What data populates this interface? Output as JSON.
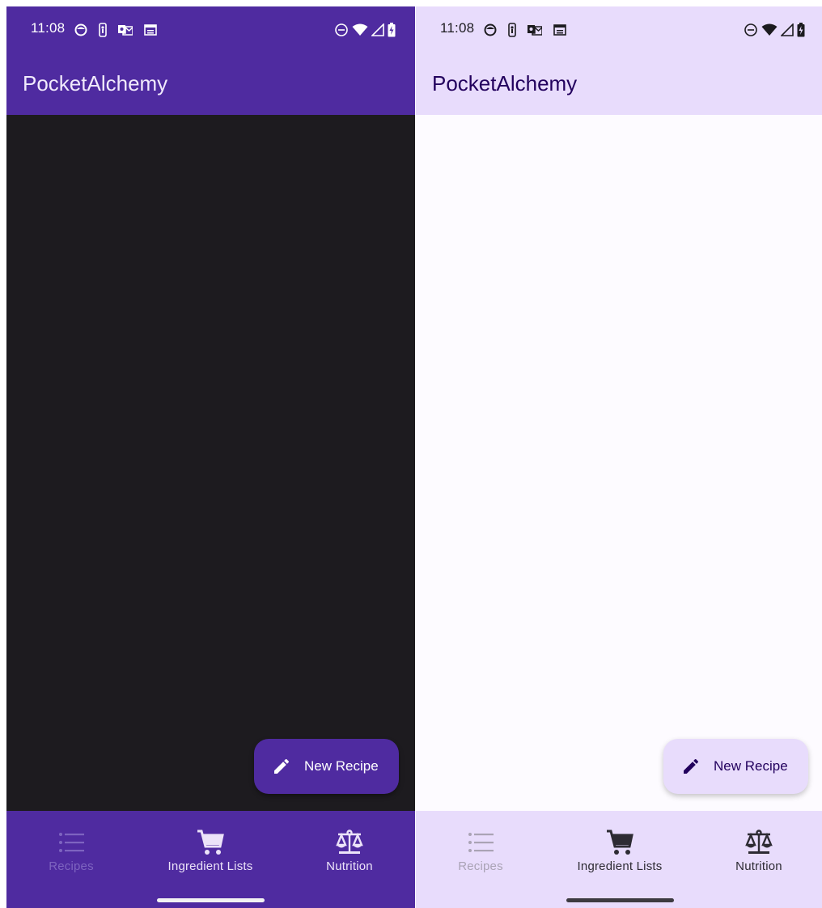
{
  "screens": [
    {
      "theme": "dark",
      "status_bar": {
        "time": "11:08",
        "notification_icons": [
          "face-icon",
          "nba-icon",
          "outlook-mail-icon",
          "calendar-icon"
        ],
        "system_icons": [
          "do-not-disturb-icon",
          "wifi-icon",
          "cell-signal-icon",
          "battery-charging-icon"
        ]
      },
      "app_bar": {
        "title": "PocketAlchemy"
      },
      "fab": {
        "label": "New Recipe",
        "icon": "pencil-icon"
      },
      "bottom_nav": {
        "items": [
          {
            "label": "Recipes",
            "icon": "list-icon",
            "state": "disabled"
          },
          {
            "label": "Ingredient Lists",
            "icon": "cart-icon",
            "state": "enabled"
          },
          {
            "label": "Nutrition",
            "icon": "scale-icon",
            "state": "enabled"
          }
        ]
      },
      "colors": {
        "primary": "#4f2ba0",
        "background": "#1d1b1f",
        "on_primary": "#ffffff"
      }
    },
    {
      "theme": "light",
      "status_bar": {
        "time": "11:08",
        "notification_icons": [
          "face-icon",
          "nba-icon",
          "outlook-mail-icon",
          "calendar-icon"
        ],
        "system_icons": [
          "do-not-disturb-icon",
          "wifi-icon",
          "cell-signal-icon",
          "battery-charging-icon"
        ]
      },
      "app_bar": {
        "title": "PocketAlchemy"
      },
      "fab": {
        "label": "New Recipe",
        "icon": "pencil-icon"
      },
      "bottom_nav": {
        "items": [
          {
            "label": "Recipes",
            "icon": "list-icon",
            "state": "disabled"
          },
          {
            "label": "Ingredient Lists",
            "icon": "cart-icon",
            "state": "enabled"
          },
          {
            "label": "Nutrition",
            "icon": "scale-icon",
            "state": "enabled"
          }
        ]
      },
      "colors": {
        "primary_container": "#e8dcfc",
        "background": "#fdfbff",
        "on_primary_container": "#22005d"
      }
    }
  ]
}
